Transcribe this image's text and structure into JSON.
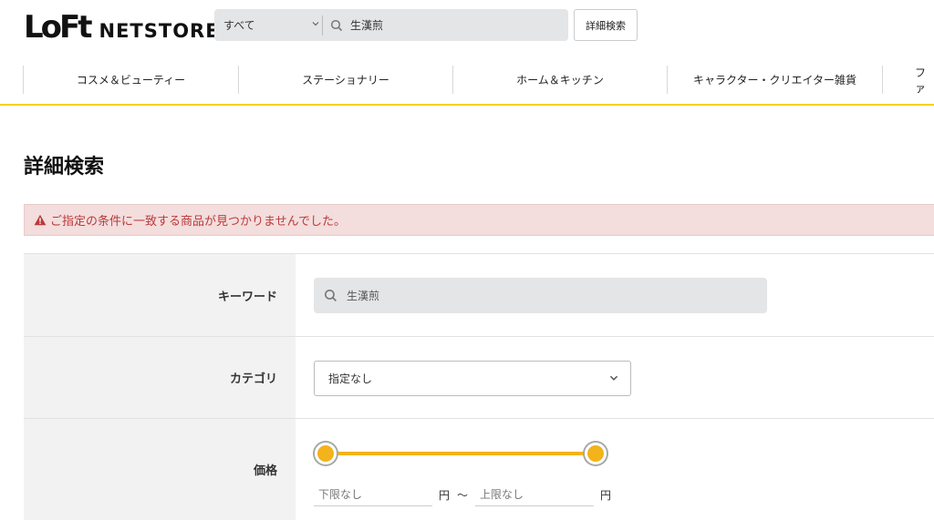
{
  "header": {
    "logo_main": "LoFt",
    "logo_sub": "NETSTORE",
    "search": {
      "scope_value": "すべて",
      "query_value": "生漢煎"
    },
    "advanced_search_label": "詳細検索"
  },
  "nav": {
    "items": [
      {
        "label": "コスメ＆ビューティー"
      },
      {
        "label": "ステーショナリー"
      },
      {
        "label": "ホーム＆キッチン"
      },
      {
        "label": "キャラクター・クリエイター雑貨"
      },
      {
        "label": "ファ"
      }
    ]
  },
  "page": {
    "title": "詳細検索",
    "alert": "ご指定の条件に一致する商品が見つかりませんでした。"
  },
  "form": {
    "keyword": {
      "label": "キーワード",
      "value": "生漢煎"
    },
    "category": {
      "label": "カテゴリ",
      "selected": "指定なし"
    },
    "price": {
      "label": "価格",
      "min_placeholder": "下限なし",
      "max_placeholder": "上限なし",
      "unit": "円",
      "separator": "〜",
      "slider_min_fraction": 0,
      "slider_max_fraction": 1
    }
  },
  "colors": {
    "accent_yellow": "#f3d21b",
    "slider_orange": "#f2b31b",
    "alert_bg": "#f4dddd",
    "alert_text": "#b93a3a"
  },
  "icons": {
    "search": "search-icon",
    "chevron": "chevron-down-icon",
    "warning": "warning-icon"
  }
}
